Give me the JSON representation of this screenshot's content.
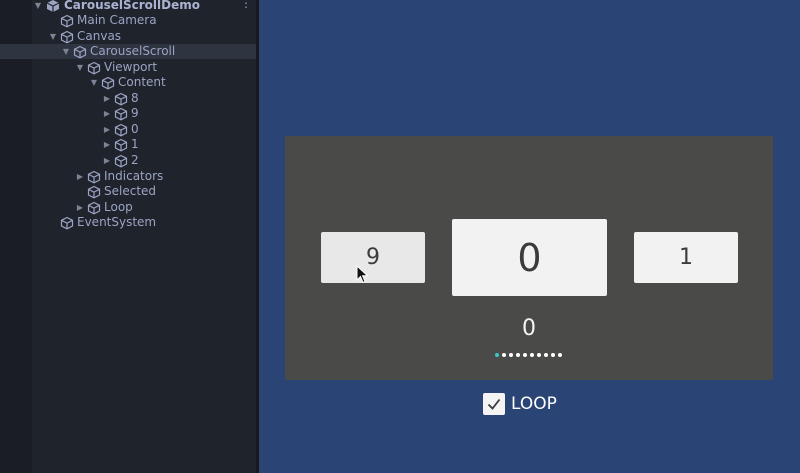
{
  "hierarchy": {
    "root": "CarouselScrollDemo",
    "items": [
      {
        "label": "Main Camera"
      },
      {
        "label": "Canvas"
      },
      {
        "label": "CarouselScroll"
      },
      {
        "label": "Viewport"
      },
      {
        "label": "Content"
      },
      {
        "label": "8"
      },
      {
        "label": "9"
      },
      {
        "label": "0"
      },
      {
        "label": "1"
      },
      {
        "label": "2"
      },
      {
        "label": "Indicators"
      },
      {
        "label": "Selected"
      },
      {
        "label": "Loop"
      },
      {
        "label": "EventSystem"
      }
    ],
    "selected_item": "CarouselScroll"
  },
  "game": {
    "cards": {
      "left": "9",
      "center": "0",
      "right": "1"
    },
    "selected_text": "0",
    "indicator_count": 10,
    "active_indicator_index": 0,
    "loop_label": "LOOP",
    "loop_checked": true
  },
  "colors": {
    "game_background": "#2a4575",
    "carousel_background": "#4a4a49",
    "indicator_active": "#3bc6c8",
    "hierarchy_background": "#1f232b"
  },
  "icons": {
    "gameobject": "cube-icon",
    "scene": "unity-scene-icon",
    "menu": "kebab-menu-icon",
    "checkmark": "checkmark-icon"
  }
}
